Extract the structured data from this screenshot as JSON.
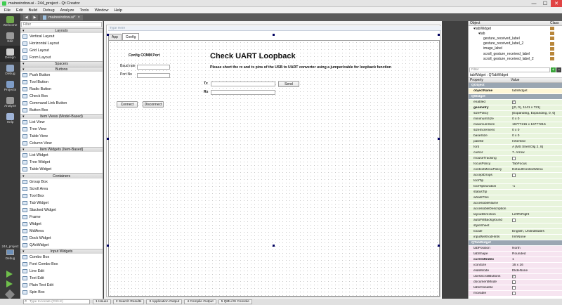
{
  "window": {
    "title": "mainwindow.ui - 244_project - Qt Creator",
    "min": "—",
    "max": "☐",
    "close": "✕"
  },
  "menu": [
    "File",
    "Edit",
    "Build",
    "Debug",
    "Analyze",
    "Tools",
    "Window",
    "Help"
  ],
  "modes": [
    {
      "label": "Welcome",
      "color": "#6fa84b"
    },
    {
      "label": "Edit",
      "color": "#9a9a9a"
    },
    {
      "label": "Design",
      "color": "#cfcfcf"
    },
    {
      "label": "Debug",
      "color": "#8fa5c4"
    },
    {
      "label": "Projects",
      "color": "#7e9cc6"
    },
    {
      "label": "Analyze",
      "color": "#9a9a9a"
    },
    {
      "label": "Help",
      "color": "#9fb4d8"
    }
  ],
  "kit": {
    "project": "244_project",
    "label": "Debug"
  },
  "doc_tab": {
    "name": "mainwindow.ui*",
    "close": "×"
  },
  "widgetbox": {
    "filter_placeholder": "Filter",
    "sections": [
      {
        "title": "Layouts",
        "items": [
          "Vertical Layout",
          "Horizontal Layout",
          "Grid Layout",
          "Form Layout"
        ]
      },
      {
        "title": "Spacers",
        "items": []
      },
      {
        "title": "Buttons",
        "items": [
          "Push Button",
          "Tool Button",
          "Radio Button",
          "Check Box",
          "Command Link Button",
          "Button Box"
        ]
      },
      {
        "title": "Item Views (Model-Based)",
        "items": [
          "List View",
          "Tree View",
          "Table View",
          "Column View"
        ]
      },
      {
        "title": "Item Widgets (Item-Based)",
        "items": [
          "List Widget",
          "Tree Widget",
          "Table Widget"
        ]
      },
      {
        "title": "Containers",
        "items": [
          "Group Box",
          "Scroll Area",
          "Tool Box",
          "Tab Widget",
          "Stacked Widget",
          "Frame",
          "Widget",
          "MdiArea",
          "Dock Widget",
          "QAxWidget"
        ]
      },
      {
        "title": "Input Widgets",
        "items": [
          "Combo Box",
          "Font Combo Box",
          "Line Edit",
          "Text Edit",
          "Plain Text Edit",
          "Spin Box"
        ]
      }
    ]
  },
  "form": {
    "type_here": "Type Here",
    "tabs": [
      "App",
      "Config"
    ],
    "active_tab": 1,
    "comm_title": "Config COMM Port",
    "baud_label": "Baud rate",
    "port_label": "Port No",
    "heading": "Check UART Loopback",
    "instructions": "Please short the rx and tx pins of the USB to UART converter using a jumper/cable for loopback function",
    "tx_label": "Tx",
    "rx_label": "Rx",
    "send": "Send",
    "connect": "Connect",
    "disconnect": "Disconnect"
  },
  "object_inspector": {
    "col_object": "Object",
    "col_class": "Class",
    "rows": [
      {
        "name": "tabWidget",
        "cls": "",
        "indent": 1
      },
      {
        "name": "tab",
        "cls": "",
        "indent": 2
      },
      {
        "name": "gesture_received_label",
        "cls": "",
        "indent": 3
      },
      {
        "name": "gesture_received_label_2",
        "cls": "",
        "indent": 3
      },
      {
        "name": "image_label",
        "cls": "",
        "indent": 3
      },
      {
        "name": "scroll_gesture_received_label",
        "cls": "",
        "indent": 3
      },
      {
        "name": "scroll_gesture_received_label_2",
        "cls": "",
        "indent": 3
      }
    ]
  },
  "property_editor": {
    "filter_placeholder": "Filter",
    "caption": "tabWidget : QTabWidget",
    "col_property": "Property",
    "col_value": "Value",
    "rows": [
      {
        "n": "QObject",
        "v": "",
        "k": "sec"
      },
      {
        "n": "objectName",
        "v": "tabWidget",
        "k": "y",
        "b": true
      },
      {
        "n": "QWidget",
        "v": "",
        "k": "sec"
      },
      {
        "n": "enabled",
        "v": "",
        "k": "g",
        "chk": "on"
      },
      {
        "n": "geometry",
        "v": "[(0, 0), 1141 x 721]",
        "k": "g",
        "b": true
      },
      {
        "n": "sizePolicy",
        "v": "[Expanding, Expanding, 0, 0]",
        "k": "g"
      },
      {
        "n": "minimumSize",
        "v": "0 x 0",
        "k": "g"
      },
      {
        "n": "maximumSize",
        "v": "16777215 x 16777215",
        "k": "g"
      },
      {
        "n": "sizeIncrement",
        "v": "0 x 0",
        "k": "g"
      },
      {
        "n": "baseSize",
        "v": "0 x 0",
        "k": "g"
      },
      {
        "n": "palette",
        "v": "Inherited",
        "k": "g"
      },
      {
        "n": "font",
        "v": "A  [MS Shell Dlg 2, 8]",
        "k": "g"
      },
      {
        "n": "cursor",
        "v": "↖  Arrow",
        "k": "g"
      },
      {
        "n": "mouseTracking",
        "v": "",
        "k": "g",
        "chk": "off"
      },
      {
        "n": "focusPolicy",
        "v": "TabFocus",
        "k": "g"
      },
      {
        "n": "contextMenuPolicy",
        "v": "DefaultContextMenu",
        "k": "g"
      },
      {
        "n": "acceptDrops",
        "v": "",
        "k": "g",
        "chk": "off"
      },
      {
        "n": "toolTip",
        "v": "",
        "k": "g"
      },
      {
        "n": "toolTipDuration",
        "v": "-1",
        "k": "g"
      },
      {
        "n": "statusTip",
        "v": "",
        "k": "g"
      },
      {
        "n": "whatsThis",
        "v": "",
        "k": "g"
      },
      {
        "n": "accessibleName",
        "v": "",
        "k": "g"
      },
      {
        "n": "accessibleDescription",
        "v": "",
        "k": "g"
      },
      {
        "n": "layoutDirection",
        "v": "LeftToRight",
        "k": "g"
      },
      {
        "n": "autoFillBackground",
        "v": "",
        "k": "g",
        "chk": "off"
      },
      {
        "n": "styleSheet",
        "v": "",
        "k": "g"
      },
      {
        "n": "locale",
        "v": "English, UnitedStates",
        "k": "g"
      },
      {
        "n": "inputMethodHints",
        "v": "ImhNone",
        "k": "g"
      },
      {
        "n": "QTabWidget",
        "v": "",
        "k": "sec"
      },
      {
        "n": "tabPosition",
        "v": "North",
        "k": "p"
      },
      {
        "n": "tabShape",
        "v": "Rounded",
        "k": "p"
      },
      {
        "n": "currentIndex",
        "v": "1",
        "k": "p",
        "b": true
      },
      {
        "n": "iconSize",
        "v": "16 x 16",
        "k": "p"
      },
      {
        "n": "elideMode",
        "v": "ElideNone",
        "k": "p"
      },
      {
        "n": "usesScrollButtons",
        "v": "",
        "k": "p",
        "chk": "on"
      },
      {
        "n": "documentMode",
        "v": "",
        "k": "p",
        "chk": "off"
      },
      {
        "n": "tabsClosable",
        "v": "",
        "k": "p",
        "chk": "off"
      },
      {
        "n": "movable",
        "v": "",
        "k": "p",
        "chk": "off"
      }
    ]
  },
  "statusbar": {
    "locate_placeholder": "Type to locate (Ctrl+K)",
    "tabs": [
      "1  Issues",
      "2  Search Results",
      "3  Application Output",
      "4  Compile Output",
      "5  QML/JS Console"
    ]
  }
}
